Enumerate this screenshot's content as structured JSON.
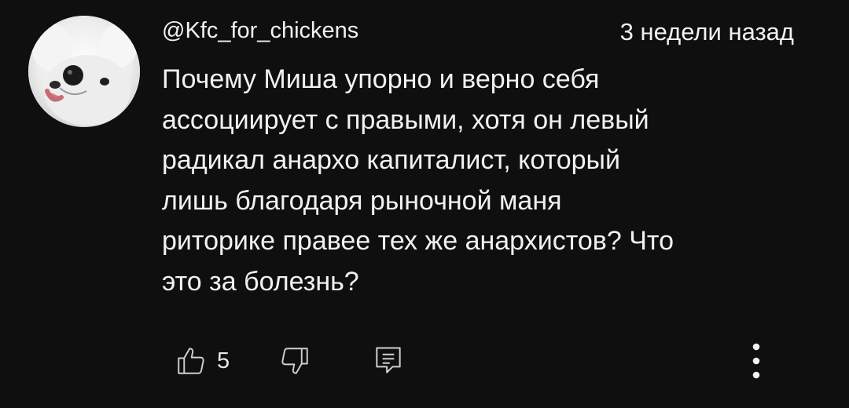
{
  "comment": {
    "author": "@Kfc_for_chickens",
    "timestamp": "3 недели назад",
    "body_lines": [
      "Почему Миша упорно и верно себя",
      "ассоциирует с правыми, хотя он левый",
      "радикал анархо капиталист, который",
      "лишь благодаря рыночной маня",
      "риторике правее тех же анархистов? Что",
      "это за болезнь?"
    ],
    "likes": "5",
    "icons": {
      "avatar": "white-dog-avatar",
      "like": "thumbs-up-icon",
      "dislike": "thumbs-down-icon",
      "reply": "reply-comment-icon",
      "more": "vertical-ellipsis-icon"
    }
  },
  "colors": {
    "background": "#0f0f0f",
    "text": "#f1f1f1",
    "icon": "#cfcfcf"
  }
}
